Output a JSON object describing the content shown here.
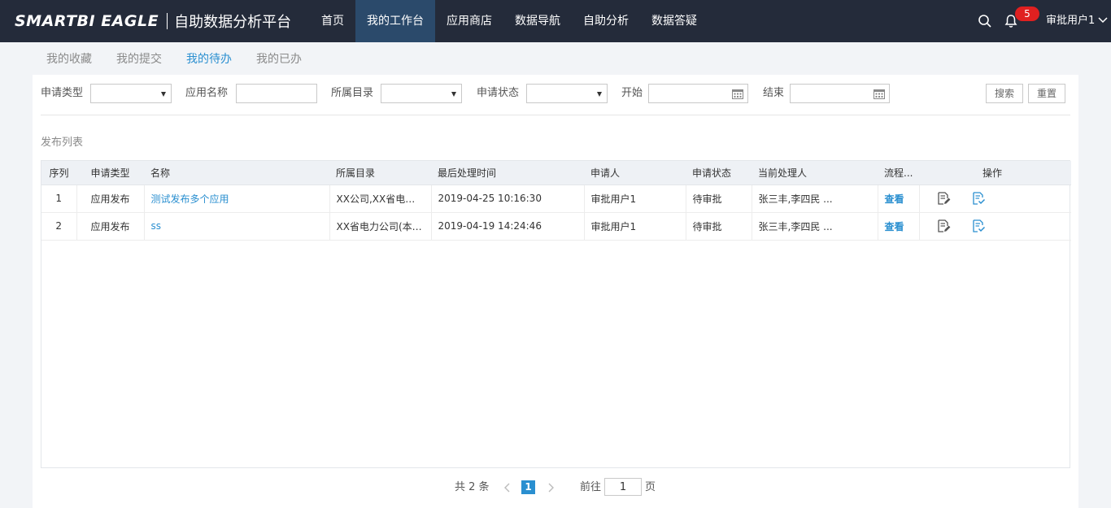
{
  "header": {
    "logo_text": "SMARTBI EAGLE",
    "platform_title": "自助数据分析平台",
    "nav": [
      {
        "label": "首页"
      },
      {
        "label": "我的工作台"
      },
      {
        "label": "应用商店"
      },
      {
        "label": "数据导航"
      },
      {
        "label": "自助分析"
      },
      {
        "label": "数据答疑"
      }
    ],
    "active_nav_index": 1,
    "notification_count": "5",
    "user_name": "审批用户1"
  },
  "subtabs": [
    {
      "label": "我的收藏"
    },
    {
      "label": "我的提交"
    },
    {
      "label": "我的待办"
    },
    {
      "label": "我的已办"
    }
  ],
  "active_subtab_index": 2,
  "filters": {
    "apply_type_label": "申请类型",
    "apply_type_value": "",
    "app_name_label": "应用名称",
    "app_name_value": "",
    "directory_label": "所属目录",
    "directory_value": "",
    "status_label": "申请状态",
    "status_value": "",
    "start_label": "开始",
    "start_value": "",
    "end_label": "结束",
    "end_value": "",
    "search_button": "搜索",
    "reset_button": "重置"
  },
  "list": {
    "title": "发布列表",
    "columns": [
      "序列",
      "申请类型",
      "名称",
      "所属目录",
      "最后处理时间",
      "申请人",
      "申请状态",
      "当前处理人",
      "流程...",
      "",
      "操作"
    ],
    "rows": [
      {
        "index": "1",
        "apply_type": "应用发布",
        "name": "测试发布多个应用",
        "directory": "XX公司,XX省电力...",
        "last_time": "2019-04-25 10:16:30",
        "applicant": "审批用户1",
        "status": "待审批",
        "handler": "张三丰,李四民 ...",
        "process": "查看",
        "op_edit_icon": "edit-doc-icon",
        "op_approve_icon": "approve-doc-icon"
      },
      {
        "index": "2",
        "apply_type": "应用发布",
        "name": "ss",
        "directory": "XX省电力公司(本部)",
        "last_time": "2019-04-19 14:24:46",
        "applicant": "审批用户1",
        "status": "待审批",
        "handler": "张三丰,李四民 ...",
        "process": "查看",
        "op_edit_icon": "edit-doc-icon",
        "op_approve_icon": "approve-doc-icon"
      }
    ]
  },
  "pagination": {
    "total_text": "共 2 条",
    "current_page": "1",
    "goto_label": "前往",
    "goto_value": "1",
    "page_unit": "页"
  },
  "colors": {
    "topbar_bg": "#242b3a",
    "active_nav_bg": "#2b4a6b",
    "accent": "#2a8fd0",
    "badge": "#e02020"
  }
}
